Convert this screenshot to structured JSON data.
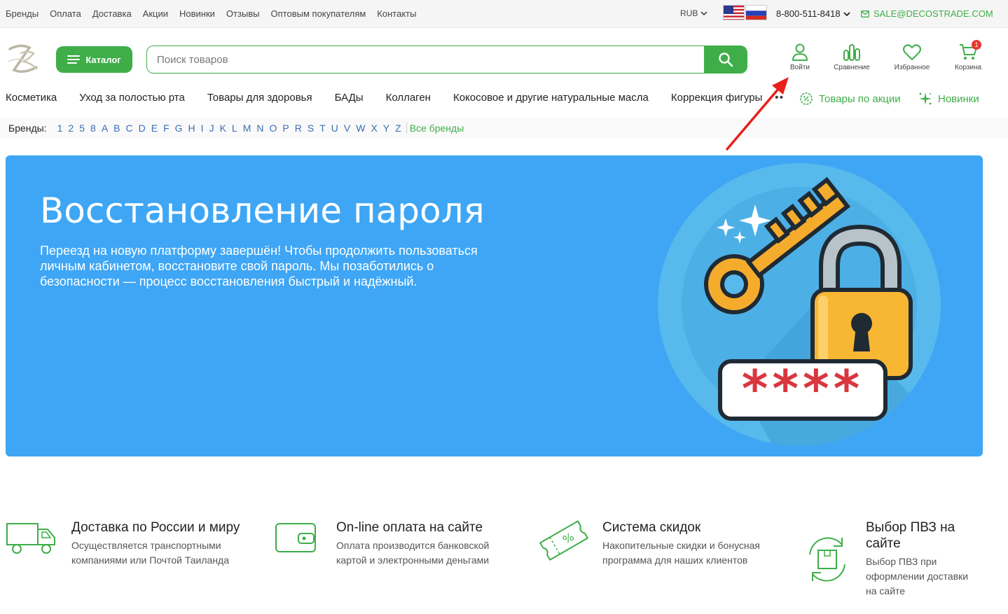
{
  "topbar": {
    "links": [
      "Бренды",
      "Оплата",
      "Доставка",
      "Акции",
      "Новинки",
      "Отзывы",
      "Оптовым покупателям",
      "Контакты"
    ],
    "currency": "RUB",
    "phone": "8-800-511-8418",
    "email": "SALE@DECOSTRADE.COM"
  },
  "header": {
    "catalog_label": "Каталог",
    "search_placeholder": "Поиск товаров",
    "login_label": "Войти",
    "compare_label": "Сравнение",
    "favorites_label": "Избранное",
    "cart_label": "Корзина",
    "cart_count": "1"
  },
  "categories": [
    "Косметика",
    "Уход за полостью рта",
    "Товары для здоровья",
    "БАДы",
    "Коллаген",
    "Кокосовое и другие натуральные масла",
    "Коррекция фигуры"
  ],
  "more_label": "••",
  "promo": {
    "sale_label": "Товары по акции",
    "new_label": "Новинки"
  },
  "brands": {
    "label": "Бренды:",
    "letters": [
      "1",
      "2",
      "5",
      "8",
      "A",
      "B",
      "C",
      "D",
      "E",
      "F",
      "G",
      "H",
      "I",
      "J",
      "K",
      "L",
      "M",
      "N",
      "O",
      "P",
      "R",
      "S",
      "T",
      "U",
      "V",
      "W",
      "X",
      "Y",
      "Z"
    ],
    "all_label": "Все бренды"
  },
  "banner": {
    "title": "Восстановление пароля",
    "text": "Переезд на новую платформу завершён! Чтобы продолжить пользоваться личным кабинетом, восстановите свой пароль. Мы позаботились о безопасности — процесс восстановления быстрый и надёжный.",
    "password_mask": "****"
  },
  "features": [
    {
      "title": "Доставка по России и миру",
      "desc": "Осуществляется транспортными компаниями или Почтой Таиланда"
    },
    {
      "title": "On-line оплата на сайте",
      "desc": "Оплата производится банковской картой и электронными деньгами"
    },
    {
      "title": "Система скидок",
      "desc": "Накопительные скидки и бонусная программа для наших клиентов"
    },
    {
      "title": "Выбор ПВЗ на сайте",
      "desc": "Выбор ПВЗ при оформлении доставки на сайте"
    }
  ],
  "colors": {
    "accent": "#3fae49",
    "banner": "#3ea6f5",
    "link": "#3a6db5",
    "badge": "#e53935",
    "arrow": "#e8201c"
  }
}
